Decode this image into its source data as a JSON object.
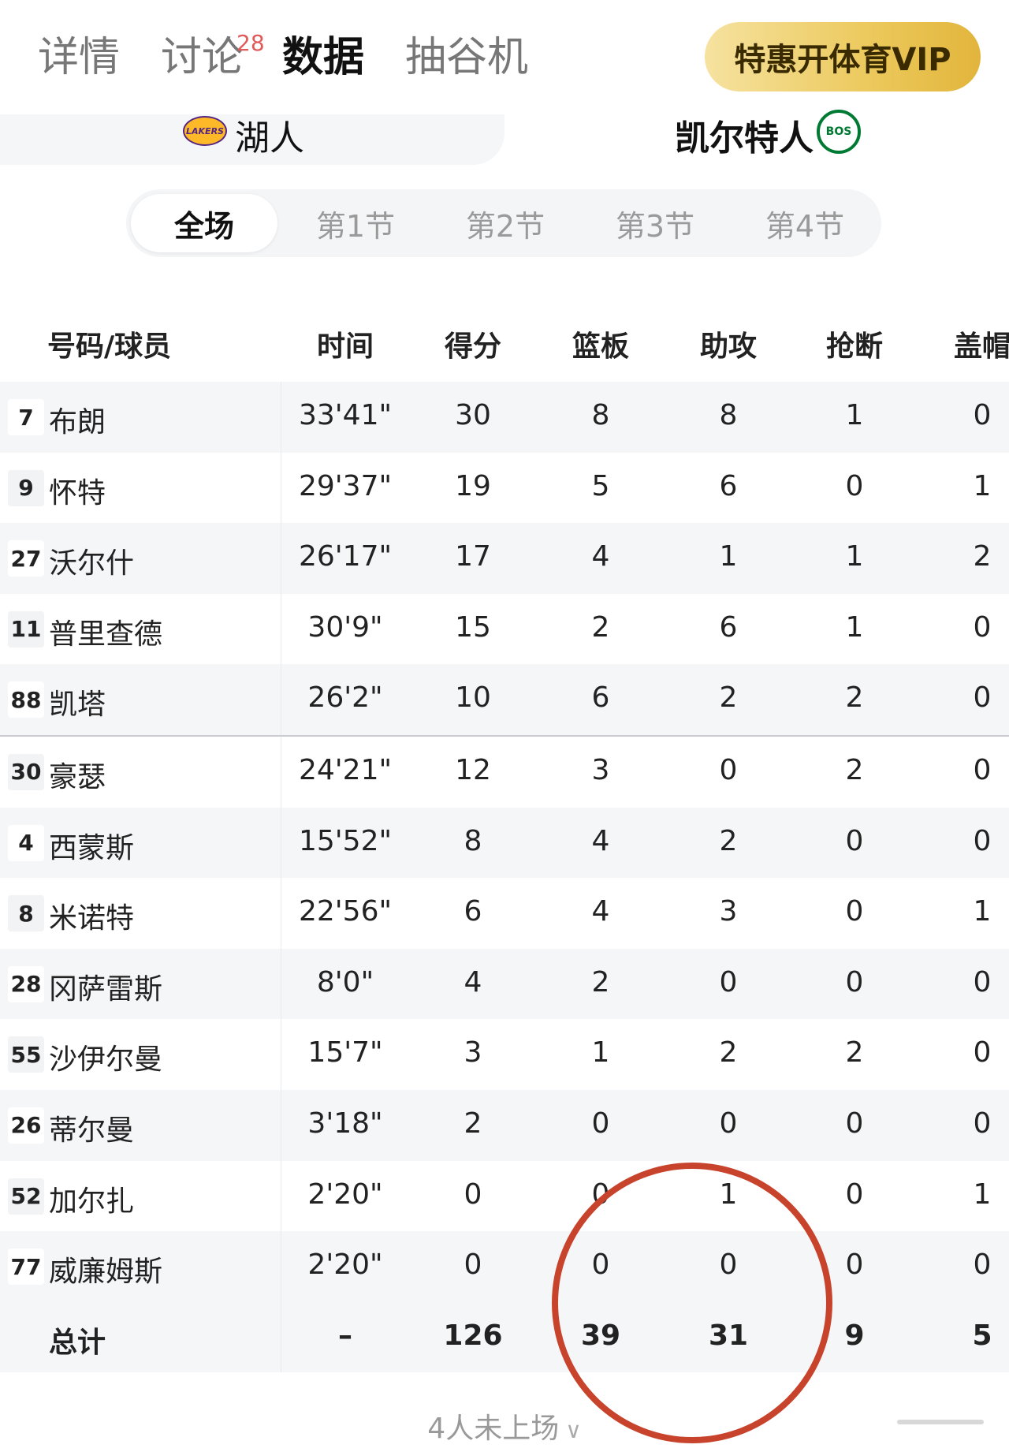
{
  "nav": {
    "tabs": [
      {
        "label": "详情"
      },
      {
        "label": "讨论"
      },
      {
        "label": "数据"
      },
      {
        "label": "抽谷机"
      }
    ],
    "discuss_badge": "28",
    "vip_label": "特惠开体育VIP"
  },
  "teams": {
    "home": {
      "name": "湖人",
      "logo_text": "LAKERS"
    },
    "away": {
      "name": "凯尔特人",
      "logo_text": "BOS"
    }
  },
  "periods": [
    "全场",
    "第1节",
    "第2节",
    "第3节",
    "第4节"
  ],
  "table": {
    "headers": {
      "player": "号码/球员",
      "time": "时间",
      "pts": "得分",
      "reb": "篮板",
      "ast": "助攻",
      "stl": "抢断",
      "blk": "盖帽"
    },
    "rows": [
      {
        "num": "7",
        "name": "布朗",
        "time": "33'41\"",
        "pts": "30",
        "reb": "8",
        "ast": "8",
        "stl": "1",
        "blk": "0"
      },
      {
        "num": "9",
        "name": "怀特",
        "time": "29'37\"",
        "pts": "19",
        "reb": "5",
        "ast": "6",
        "stl": "0",
        "blk": "1"
      },
      {
        "num": "27",
        "name": "沃尔什",
        "time": "26'17\"",
        "pts": "17",
        "reb": "4",
        "ast": "1",
        "stl": "1",
        "blk": "2"
      },
      {
        "num": "11",
        "name": "普里查德",
        "time": "30'9\"",
        "pts": "15",
        "reb": "2",
        "ast": "6",
        "stl": "1",
        "blk": "0"
      },
      {
        "num": "88",
        "name": "凯塔",
        "time": "26'2\"",
        "pts": "10",
        "reb": "6",
        "ast": "2",
        "stl": "2",
        "blk": "0"
      },
      {
        "num": "30",
        "name": "豪瑟",
        "time": "24'21\"",
        "pts": "12",
        "reb": "3",
        "ast": "0",
        "stl": "2",
        "blk": "0"
      },
      {
        "num": "4",
        "name": "西蒙斯",
        "time": "15'52\"",
        "pts": "8",
        "reb": "4",
        "ast": "2",
        "stl": "0",
        "blk": "0"
      },
      {
        "num": "8",
        "name": "米诺特",
        "time": "22'56\"",
        "pts": "6",
        "reb": "4",
        "ast": "3",
        "stl": "0",
        "blk": "1"
      },
      {
        "num": "28",
        "name": "冈萨雷斯",
        "time": "8'0\"",
        "pts": "4",
        "reb": "2",
        "ast": "0",
        "stl": "0",
        "blk": "0"
      },
      {
        "num": "55",
        "name": "沙伊尔曼",
        "time": "15'7\"",
        "pts": "3",
        "reb": "1",
        "ast": "2",
        "stl": "2",
        "blk": "0"
      },
      {
        "num": "26",
        "name": "蒂尔曼",
        "time": "3'18\"",
        "pts": "2",
        "reb": "0",
        "ast": "0",
        "stl": "0",
        "blk": "0"
      },
      {
        "num": "52",
        "name": "加尔扎",
        "time": "2'20\"",
        "pts": "0",
        "reb": "0",
        "ast": "1",
        "stl": "0",
        "blk": "1"
      },
      {
        "num": "77",
        "name": "威廉姆斯",
        "time": "2'20\"",
        "pts": "0",
        "reb": "0",
        "ast": "0",
        "stl": "0",
        "blk": "0"
      }
    ],
    "total": {
      "label": "总计",
      "time": "–",
      "pts": "126",
      "reb": "39",
      "ast": "31",
      "stl": "9",
      "blk": "5"
    }
  },
  "footer": {
    "more_label": "4人未上场"
  },
  "colors": {
    "accent_gold": "#ecc95c",
    "annotation_red": "#c8432c",
    "row_alt": "#f5f6f8"
  }
}
